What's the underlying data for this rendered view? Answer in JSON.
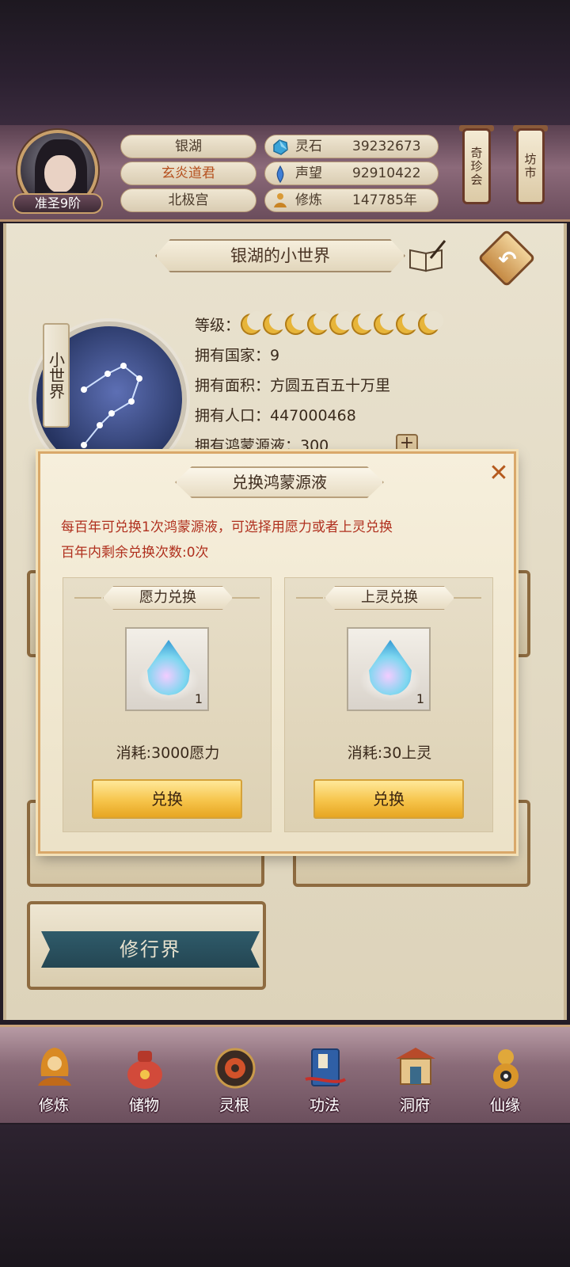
{
  "header": {
    "rank": "准圣9阶",
    "identity": [
      "银湖",
      "玄炎道君",
      "北极宫"
    ],
    "identity_highlight_color": "#b5501e",
    "resources": [
      {
        "icon": "spirit-stone-icon",
        "label": "灵石",
        "value": "39232673"
      },
      {
        "icon": "reputation-icon",
        "label": "声望",
        "value": "92910422"
      },
      {
        "icon": "meditation-icon",
        "label": "修炼",
        "value": "147785年"
      }
    ],
    "hang_buttons": [
      "奇珍会",
      "坊市"
    ]
  },
  "world": {
    "title": "银湖的小世界",
    "scroll_label": "小世界",
    "level_label": "等级：",
    "level_moons": 9,
    "countries": "拥有国家：9",
    "area": "拥有面积：方圆五百五十万里",
    "population": "拥有人口：447000468",
    "liquid": "拥有鸿蒙源液：300"
  },
  "modal": {
    "title": "兑换鸿蒙源液",
    "notice_1": "每百年可兑换1次鸿蒙源液，可选择用愿力或者上灵兑换",
    "notice_2": "百年内剩余兑换次数:0次",
    "options": [
      {
        "title": "愿力兑换",
        "qty": "1",
        "cost": "消耗:3000愿力",
        "button": "兑换"
      },
      {
        "title": "上灵兑换",
        "qty": "1",
        "cost": "消耗:30上灵",
        "button": "兑换"
      }
    ]
  },
  "cultivate_label": "修行界",
  "nav": [
    "修炼",
    "储物",
    "灵根",
    "功法",
    "洞府",
    "仙缘"
  ]
}
